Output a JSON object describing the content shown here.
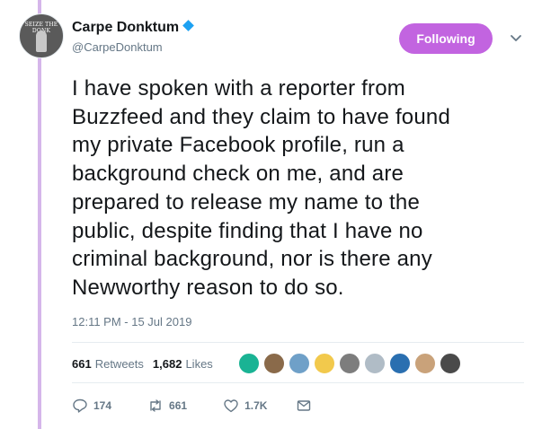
{
  "author": {
    "avatar_text": "SEIZE THE DONK",
    "display_name": "Carpe Donktum",
    "handle": "@CarpeDonktum",
    "verified_icon": "verified-badge-icon"
  },
  "follow_button": {
    "label": "Following",
    "color": "#c264e0"
  },
  "tweet": {
    "lines": [
      "I have spoken with a reporter from",
      "Buzzfeed and they claim to have found",
      "my private Facebook profile, run a",
      "background check on me, and are",
      "prepared to release my name to the",
      "public, despite finding that I have no",
      "criminal background, nor is there any",
      "Newworthy reason to do so."
    ],
    "timestamp": "12:11 PM - 15 Jul 2019"
  },
  "stats": {
    "retweets_count": "661",
    "retweets_label": "Retweets",
    "likes_count": "1,682",
    "likes_label": "Likes"
  },
  "likers": [
    {
      "name": "liker-1",
      "color": "#1ab394"
    },
    {
      "name": "liker-2",
      "color": "#8a6a4a"
    },
    {
      "name": "liker-3",
      "color": "#6fa0c8"
    },
    {
      "name": "liker-4",
      "color": "#f2c94c"
    },
    {
      "name": "liker-5",
      "color": "#7d7d7d"
    },
    {
      "name": "liker-6",
      "color": "#b0bcc6"
    },
    {
      "name": "liker-7",
      "color": "#2a6fb0"
    },
    {
      "name": "liker-8",
      "color": "#c9a27a"
    },
    {
      "name": "liker-9",
      "color": "#4a4a4a"
    }
  ],
  "actions": {
    "reply_count": "174",
    "retweet_count": "661",
    "like_count": "1.7K"
  }
}
